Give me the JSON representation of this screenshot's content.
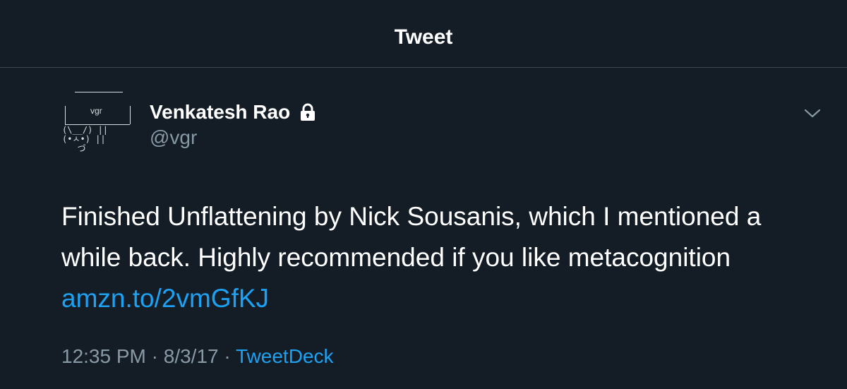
{
  "header": {
    "title": "Tweet"
  },
  "tweet": {
    "avatar": {
      "sign_text": "vgr",
      "art_line1": "(\\__/) ||",
      "art_line2": "(•ㅅ•) ||",
      "art_line3": "   づ"
    },
    "author": {
      "display_name": "Venkatesh Rao",
      "handle": "@vgr",
      "protected_icon": "lock-icon"
    },
    "menu_icon": "chevron-down-icon",
    "text_line1": "Finished Unflattening by Nick Sousanis, which I mentioned a",
    "text_line2": "while back. Highly recommended if you like metacognition",
    "link": "amzn.to/2vmGfKJ",
    "time": "12:35 PM",
    "separator1": " · ",
    "date": "8/3/17",
    "separator2": " · ",
    "source": "TweetDeck"
  },
  "colors": {
    "background": "#141d26",
    "link": "#1da1f2",
    "secondary_text": "#8899a6",
    "divider": "#3a4654"
  }
}
